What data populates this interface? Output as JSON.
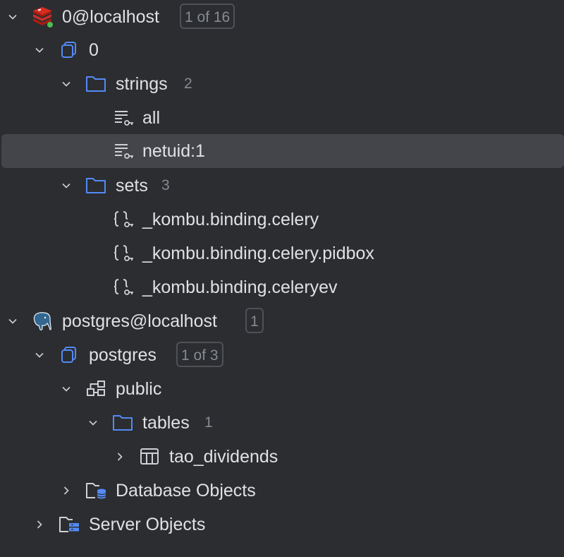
{
  "tree": {
    "redis_conn": {
      "label": "0@localhost",
      "badge": "1 of 16",
      "status_color": "#4dbe52",
      "icon": "redis-icon"
    },
    "redis_db": {
      "label": "0",
      "icon": "database-icon"
    },
    "strings_folder": {
      "label": "strings",
      "count": "2"
    },
    "string_keys": [
      "all",
      "netuid:1"
    ],
    "sets_folder": {
      "label": "sets",
      "count": "3"
    },
    "set_keys": [
      "_kombu.binding.celery",
      "_kombu.binding.celery.pidbox",
      "_kombu.binding.celeryev"
    ],
    "pg_conn": {
      "label": "postgres@localhost",
      "badge": "1",
      "icon": "postgresql-elephant-icon"
    },
    "pg_db": {
      "label": "postgres",
      "badge": "1 of 3"
    },
    "schema": {
      "label": "public"
    },
    "tables_folder": {
      "label": "tables",
      "count": "1"
    },
    "table": {
      "label": "tao_dividends"
    },
    "db_objects": {
      "label": "Database Objects"
    },
    "server_objects": {
      "label": "Server Objects"
    }
  },
  "colors": {
    "background": "#2b2d30",
    "selection": "#43454a",
    "accent_blue": "#548af7",
    "text": "#dfe1e5",
    "muted": "#868a91"
  }
}
